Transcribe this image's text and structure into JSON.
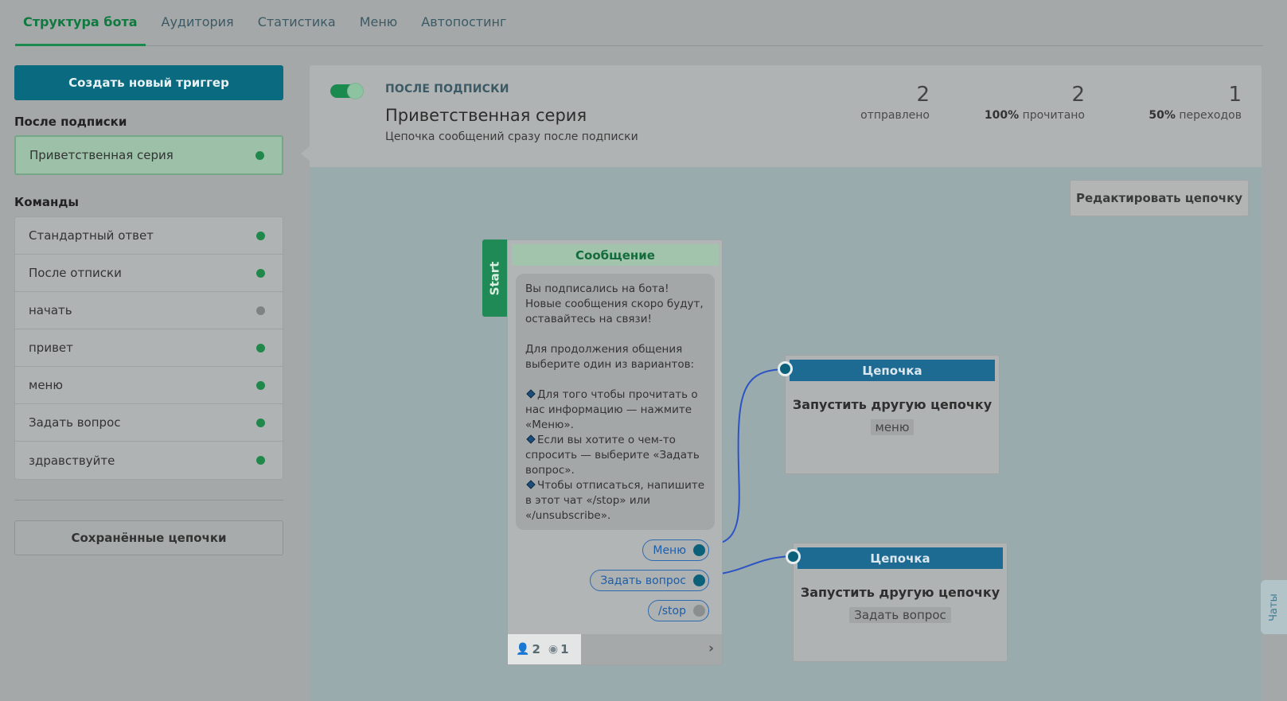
{
  "tabs": [
    {
      "label": "Структура бота",
      "active": true
    },
    {
      "label": "Аудитория"
    },
    {
      "label": "Статистика"
    },
    {
      "label": "Меню"
    },
    {
      "label": "Автопостинг"
    }
  ],
  "sidebar": {
    "create_button": "Создать новый триггер",
    "after_subscribe_title": "После подписки",
    "after_subscribe_items": [
      {
        "label": "Приветственная серия",
        "status": "active"
      }
    ],
    "commands_title": "Команды",
    "commands": [
      {
        "label": "Стандартный ответ",
        "status": "active"
      },
      {
        "label": "После отписки",
        "status": "active"
      },
      {
        "label": "начать",
        "status": "inactive"
      },
      {
        "label": "привет",
        "status": "active"
      },
      {
        "label": "меню",
        "status": "active"
      },
      {
        "label": "Задать вопрос",
        "status": "active"
      },
      {
        "label": "здравствуйте",
        "status": "active"
      }
    ],
    "saved_chains_button": "Сохранённые цепочки"
  },
  "header": {
    "kicker": "ПОСЛЕ ПОДПИСКИ",
    "title": "Приветственная серия",
    "subtitle": "Цепочка сообщений сразу после подписки",
    "toggle_on": true,
    "stats": {
      "sent": {
        "value": "2",
        "label": "отправлено"
      },
      "read": {
        "value": "2",
        "percent": "100%",
        "label": "прочитано"
      },
      "clicks": {
        "value": "1",
        "percent": "50%",
        "label": "переходов"
      }
    }
  },
  "canvas": {
    "edit_button": "Редактировать цепочку",
    "start_label": "Start",
    "message_node": {
      "header": "Сообщение",
      "text": {
        "p1": "Вы подписались на бота! Новые сообщения скоро будут, оставайтесь на связи!",
        "p2": "Для продолжения общения выберите один из вариантов:",
        "b1": "Для того чтобы прочитать о нас информацию — нажмите «Меню».",
        "b2": "Если вы хотите о чем-то спросить — выберите «Задать вопрос».",
        "b3": "Чтобы отписаться, напишите в этот чат «/stop» или «/unsubscribe»."
      },
      "buttons": [
        {
          "label": "Меню"
        },
        {
          "label": "Задать вопрос"
        },
        {
          "label": "/stop"
        }
      ],
      "footer": {
        "users": "2",
        "views": "1"
      }
    },
    "chain_nodes": [
      {
        "header": "Цепочка",
        "action": "Запустить другую цепочку",
        "tag": "меню"
      },
      {
        "header": "Цепочка",
        "action": "Запустить другую цепочку",
        "tag": "Задать вопрос"
      }
    ]
  },
  "chats_tab": "Чаты",
  "colors": {
    "accent_green": "#1b8a4e",
    "primary_teal": "#0a6a80",
    "chain_blue": "#1d6a93",
    "link_blue": "#2d54c4"
  }
}
